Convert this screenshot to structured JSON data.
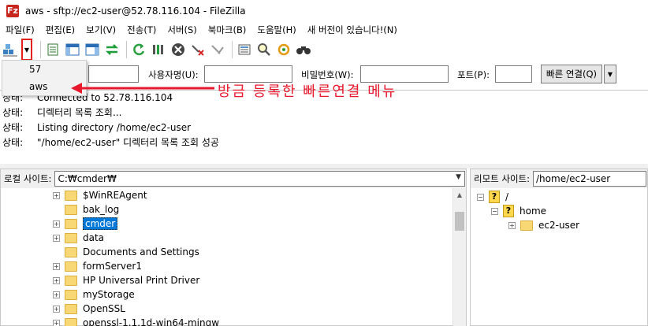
{
  "window": {
    "title": "aws - sftp://ec2-user@52.78.116.104 - FileZilla",
    "app_icon": "Fz"
  },
  "menu": [
    "파일(F)",
    "편집(E)",
    "보기(V)",
    "전송(T)",
    "서버(S)",
    "북마크(B)",
    "도움말(H)",
    "새 버전이 있습니다!(N)"
  ],
  "quickconnect": {
    "user_label": "사용자명(U):",
    "pass_label": "비밀번호(W):",
    "port_label": "포트(P):",
    "connect_label": "빠른 연결(Q)"
  },
  "dropdown": {
    "items": [
      "57",
      "aws"
    ]
  },
  "annotation": {
    "text": "방금 등록한 빠른연결 메뉴",
    "color": "#e8192c"
  },
  "log": [
    {
      "status": "상태:",
      "message": "Connected to 52.78.116.104"
    },
    {
      "status": "상태:",
      "message": "디렉터리 목록 조회..."
    },
    {
      "status": "상태:",
      "message": "Listing directory /home/ec2-user"
    },
    {
      "status": "상태:",
      "message": "\"/home/ec2-user\" 디렉터리 목록 조회 성공"
    }
  ],
  "local": {
    "label": "로컬 사이트:",
    "path": "C:₩cmder₩",
    "tree": [
      {
        "name": "$WinREAgent",
        "expandable": true
      },
      {
        "name": "bak_log",
        "expandable": false
      },
      {
        "name": "cmder",
        "expandable": true,
        "selected": true
      },
      {
        "name": "data",
        "expandable": true
      },
      {
        "name": "Documents and Settings",
        "expandable": false
      },
      {
        "name": "formServer1",
        "expandable": true
      },
      {
        "name": "HP Universal Print Driver",
        "expandable": true
      },
      {
        "name": "myStorage",
        "expandable": true
      },
      {
        "name": "OpenSSL",
        "expandable": true
      },
      {
        "name": "openssl-1.1.1d-win64-mingw",
        "expandable": true
      }
    ]
  },
  "remote": {
    "label": "리모트 사이트:",
    "path": "/home/ec2-user",
    "tree": [
      {
        "name": "/",
        "type": "unknown"
      },
      {
        "name": "home",
        "type": "unknown"
      },
      {
        "name": "ec2-user",
        "type": "folder"
      }
    ]
  },
  "colors": {
    "accent": "#0078d7",
    "annotation": "#e8192c",
    "folder": "#f8d775"
  }
}
